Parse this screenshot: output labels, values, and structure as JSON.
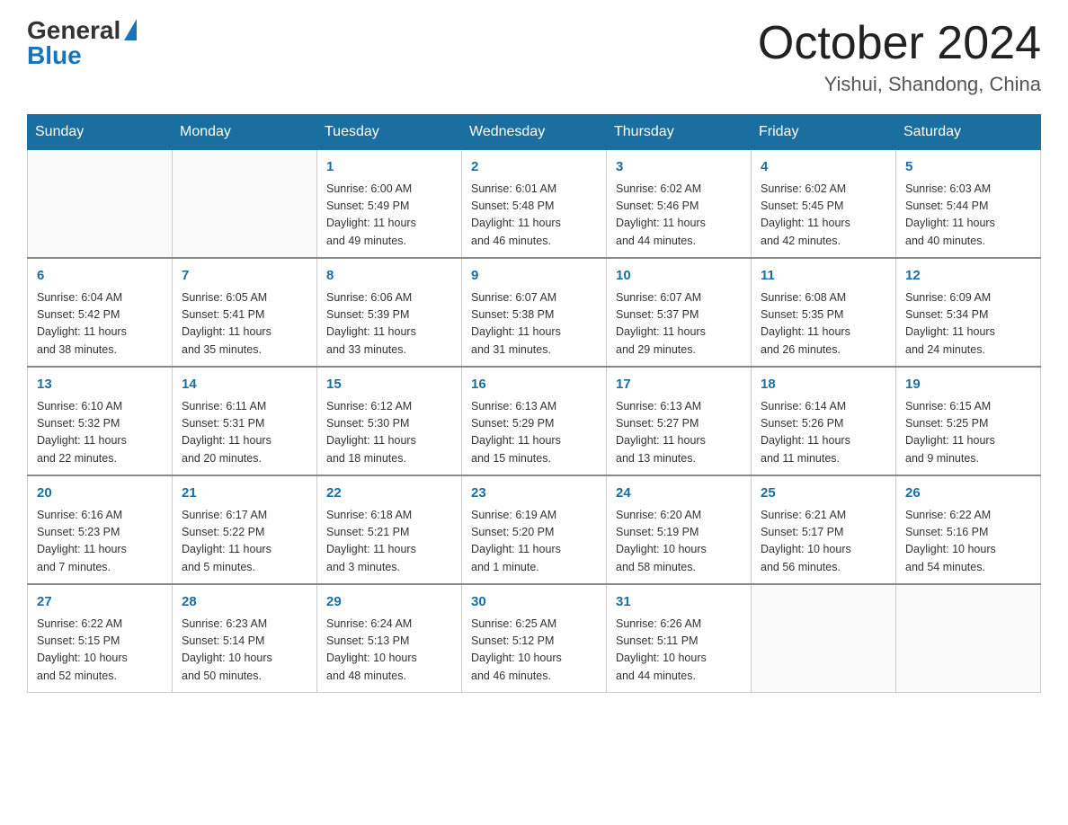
{
  "header": {
    "logo_general": "General",
    "logo_blue": "Blue",
    "month_title": "October 2024",
    "location": "Yishui, Shandong, China"
  },
  "weekdays": [
    "Sunday",
    "Monday",
    "Tuesday",
    "Wednesday",
    "Thursday",
    "Friday",
    "Saturday"
  ],
  "weeks": [
    [
      {
        "day": "",
        "info": ""
      },
      {
        "day": "",
        "info": ""
      },
      {
        "day": "1",
        "info": "Sunrise: 6:00 AM\nSunset: 5:49 PM\nDaylight: 11 hours\nand 49 minutes."
      },
      {
        "day": "2",
        "info": "Sunrise: 6:01 AM\nSunset: 5:48 PM\nDaylight: 11 hours\nand 46 minutes."
      },
      {
        "day": "3",
        "info": "Sunrise: 6:02 AM\nSunset: 5:46 PM\nDaylight: 11 hours\nand 44 minutes."
      },
      {
        "day": "4",
        "info": "Sunrise: 6:02 AM\nSunset: 5:45 PM\nDaylight: 11 hours\nand 42 minutes."
      },
      {
        "day": "5",
        "info": "Sunrise: 6:03 AM\nSunset: 5:44 PM\nDaylight: 11 hours\nand 40 minutes."
      }
    ],
    [
      {
        "day": "6",
        "info": "Sunrise: 6:04 AM\nSunset: 5:42 PM\nDaylight: 11 hours\nand 38 minutes."
      },
      {
        "day": "7",
        "info": "Sunrise: 6:05 AM\nSunset: 5:41 PM\nDaylight: 11 hours\nand 35 minutes."
      },
      {
        "day": "8",
        "info": "Sunrise: 6:06 AM\nSunset: 5:39 PM\nDaylight: 11 hours\nand 33 minutes."
      },
      {
        "day": "9",
        "info": "Sunrise: 6:07 AM\nSunset: 5:38 PM\nDaylight: 11 hours\nand 31 minutes."
      },
      {
        "day": "10",
        "info": "Sunrise: 6:07 AM\nSunset: 5:37 PM\nDaylight: 11 hours\nand 29 minutes."
      },
      {
        "day": "11",
        "info": "Sunrise: 6:08 AM\nSunset: 5:35 PM\nDaylight: 11 hours\nand 26 minutes."
      },
      {
        "day": "12",
        "info": "Sunrise: 6:09 AM\nSunset: 5:34 PM\nDaylight: 11 hours\nand 24 minutes."
      }
    ],
    [
      {
        "day": "13",
        "info": "Sunrise: 6:10 AM\nSunset: 5:32 PM\nDaylight: 11 hours\nand 22 minutes."
      },
      {
        "day": "14",
        "info": "Sunrise: 6:11 AM\nSunset: 5:31 PM\nDaylight: 11 hours\nand 20 minutes."
      },
      {
        "day": "15",
        "info": "Sunrise: 6:12 AM\nSunset: 5:30 PM\nDaylight: 11 hours\nand 18 minutes."
      },
      {
        "day": "16",
        "info": "Sunrise: 6:13 AM\nSunset: 5:29 PM\nDaylight: 11 hours\nand 15 minutes."
      },
      {
        "day": "17",
        "info": "Sunrise: 6:13 AM\nSunset: 5:27 PM\nDaylight: 11 hours\nand 13 minutes."
      },
      {
        "day": "18",
        "info": "Sunrise: 6:14 AM\nSunset: 5:26 PM\nDaylight: 11 hours\nand 11 minutes."
      },
      {
        "day": "19",
        "info": "Sunrise: 6:15 AM\nSunset: 5:25 PM\nDaylight: 11 hours\nand 9 minutes."
      }
    ],
    [
      {
        "day": "20",
        "info": "Sunrise: 6:16 AM\nSunset: 5:23 PM\nDaylight: 11 hours\nand 7 minutes."
      },
      {
        "day": "21",
        "info": "Sunrise: 6:17 AM\nSunset: 5:22 PM\nDaylight: 11 hours\nand 5 minutes."
      },
      {
        "day": "22",
        "info": "Sunrise: 6:18 AM\nSunset: 5:21 PM\nDaylight: 11 hours\nand 3 minutes."
      },
      {
        "day": "23",
        "info": "Sunrise: 6:19 AM\nSunset: 5:20 PM\nDaylight: 11 hours\nand 1 minute."
      },
      {
        "day": "24",
        "info": "Sunrise: 6:20 AM\nSunset: 5:19 PM\nDaylight: 10 hours\nand 58 minutes."
      },
      {
        "day": "25",
        "info": "Sunrise: 6:21 AM\nSunset: 5:17 PM\nDaylight: 10 hours\nand 56 minutes."
      },
      {
        "day": "26",
        "info": "Sunrise: 6:22 AM\nSunset: 5:16 PM\nDaylight: 10 hours\nand 54 minutes."
      }
    ],
    [
      {
        "day": "27",
        "info": "Sunrise: 6:22 AM\nSunset: 5:15 PM\nDaylight: 10 hours\nand 52 minutes."
      },
      {
        "day": "28",
        "info": "Sunrise: 6:23 AM\nSunset: 5:14 PM\nDaylight: 10 hours\nand 50 minutes."
      },
      {
        "day": "29",
        "info": "Sunrise: 6:24 AM\nSunset: 5:13 PM\nDaylight: 10 hours\nand 48 minutes."
      },
      {
        "day": "30",
        "info": "Sunrise: 6:25 AM\nSunset: 5:12 PM\nDaylight: 10 hours\nand 46 minutes."
      },
      {
        "day": "31",
        "info": "Sunrise: 6:26 AM\nSunset: 5:11 PM\nDaylight: 10 hours\nand 44 minutes."
      },
      {
        "day": "",
        "info": ""
      },
      {
        "day": "",
        "info": ""
      }
    ]
  ]
}
